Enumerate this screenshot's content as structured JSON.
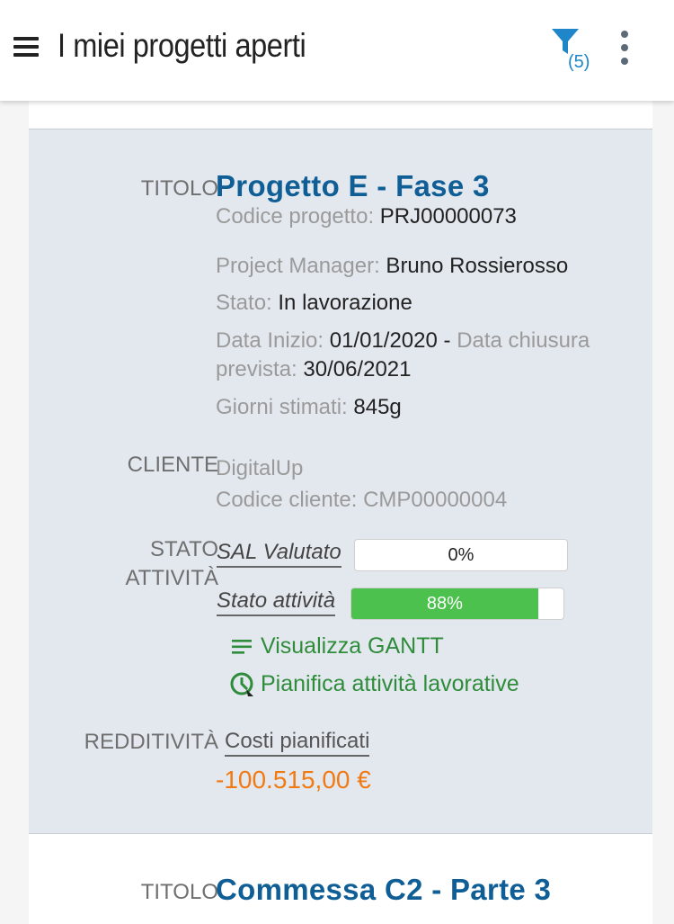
{
  "header": {
    "title": "I miei progetti aperti",
    "filter_count": "(5)",
    "accent": "#1f86c9"
  },
  "project": {
    "title_label": "TITOLO",
    "name": "Progetto E - Fase 3",
    "code_label": "Codice progetto:",
    "code": " PRJ00000073",
    "pm_label": "Project Manager:",
    "pm": " Bruno Rossierosso",
    "status_label": "Stato:",
    "status": " In lavorazione",
    "start_label": "Data Inizio:",
    "start": " 01/01/2020",
    "sep": " - ",
    "close_label_1": "Data chiusura",
    "close_label_2": "prevista:",
    "close": " 30/06/2021",
    "days_label": "Giorni stimati:",
    "days": " 845g",
    "client_label": "CLIENTE",
    "client_name": "DigitalUp",
    "client_code": "Codice cliente: CMP00000004",
    "activity_label_1": "STATO",
    "activity_label_2": "ATTIVITÀ",
    "sal_label": "SAL Valutato",
    "sal_value": 0,
    "sal_text": "0%",
    "activity_state_label": "Stato attività",
    "activity_value": 88,
    "activity_text": "88%",
    "gantt_label": "Visualizza GANTT",
    "plan_label": "Pianifica attività lavorative",
    "profit_label": "REDDITIVITÀ",
    "costs_label": "Costi pianificati",
    "costs_value": "-100.515,00 €"
  },
  "next_project": {
    "title_label": "TITOLO",
    "name": "Commessa C2 - Parte 3"
  }
}
